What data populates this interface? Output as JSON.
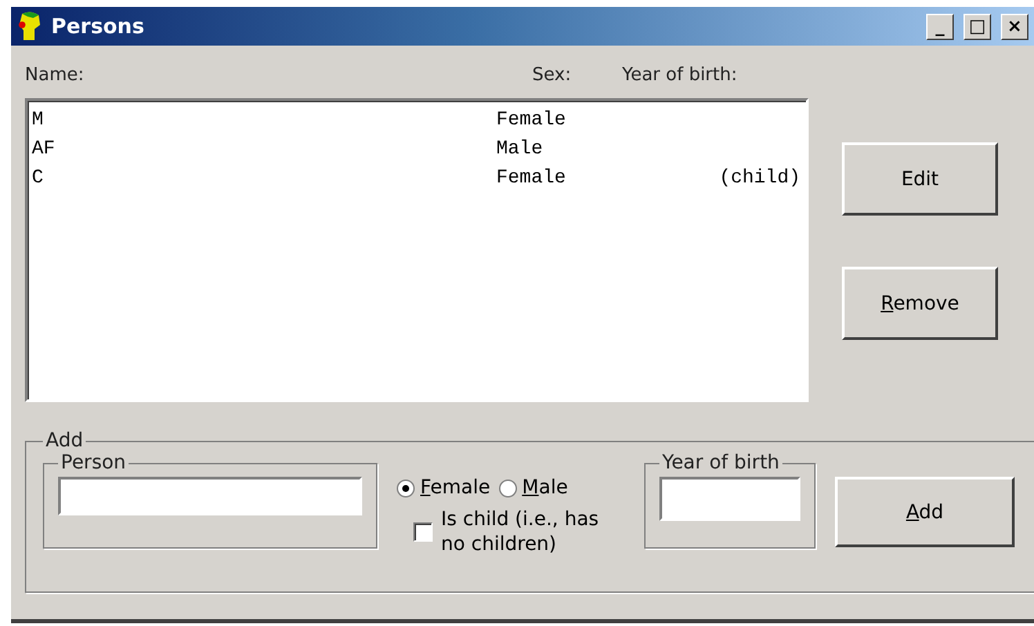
{
  "window": {
    "title": "Persons",
    "controls": [
      "_",
      "□",
      "×"
    ]
  },
  "list": {
    "headers": [
      "Name:",
      "Sex:",
      "Year of birth:"
    ],
    "rows": [
      {
        "name": "M",
        "sex": "Female"
      },
      {
        "name": "AF",
        "sex": "Male"
      },
      {
        "name": "C",
        "sex": "Female",
        "year": "(child)"
      }
    ]
  },
  "buttons": [
    "Edit",
    "Remove"
  ],
  "add": {
    "title": "Add",
    "person": {
      "title": "Person"
    },
    "sex": [
      {
        "label": "Female",
        "selected": true
      },
      {
        "label": "Male",
        "selected": false
      }
    ],
    "is_child": {
      "label": "Is child (i.e., has no children)",
      "checked": false
    },
    "year": {
      "title": "Year of birth"
    },
    "button": "Add"
  }
}
